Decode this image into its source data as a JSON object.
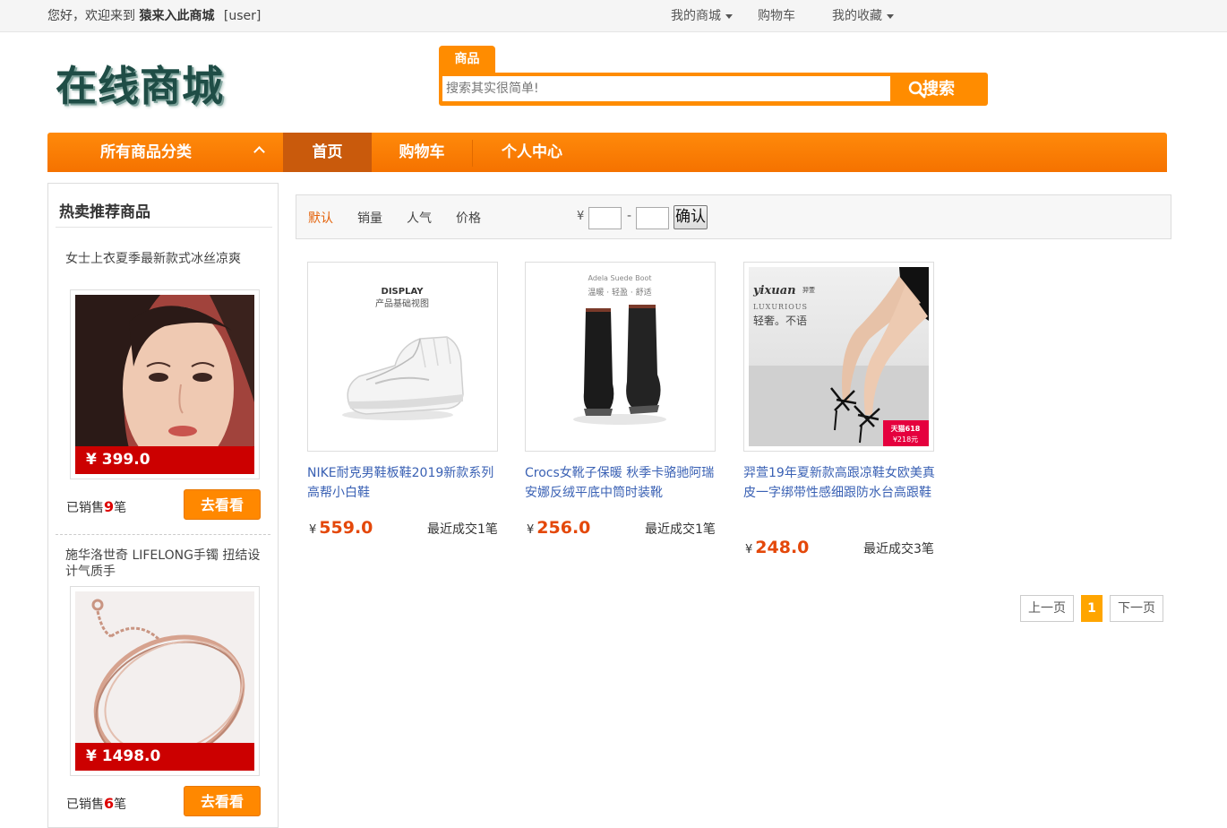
{
  "topbar": {
    "welcome_prefix": "您好，欢迎来到",
    "site_name": "猿来入此商城",
    "user_tag": "[user]",
    "links": [
      {
        "label": "我的商城",
        "dropdown": true
      },
      {
        "label": "购物车",
        "dropdown": false
      },
      {
        "label": "我的收藏",
        "dropdown": true
      }
    ]
  },
  "header": {
    "logo_text": "在线商城",
    "search_tab": "商品",
    "search_placeholder": "搜索其实很简单!",
    "search_button": "搜索"
  },
  "nav": {
    "category_label": "所有商品分类",
    "items": [
      {
        "label": "首页",
        "active": true
      },
      {
        "label": "购物车",
        "active": false
      },
      {
        "label": "个人中心",
        "active": false
      }
    ],
    "accent_color": "#f57200"
  },
  "sidebar": {
    "title": "热卖推荐商品",
    "sold_prefix": "已销售",
    "sold_suffix": "笔",
    "button_label": "去看看",
    "items": [
      {
        "name": "女士上衣夏季最新款式冰丝凉爽",
        "price": "¥ 399.0",
        "sold": "9"
      },
      {
        "name": "施华洛世奇 LIFELONG手镯 扭结设计气质手",
        "price": "¥ 1498.0",
        "sold": "6"
      }
    ]
  },
  "sortbar": {
    "options": [
      {
        "label": "默认",
        "active": true
      },
      {
        "label": "销量",
        "active": false
      },
      {
        "label": "人气",
        "active": false
      },
      {
        "label": "价格",
        "active": false
      }
    ],
    "currency": "¥",
    "range_sep": "-",
    "confirm": "确认"
  },
  "products": [
    {
      "title": "NIKE耐克男鞋板鞋2019新款系列高帮小白鞋",
      "currency": "¥",
      "price": "559.0",
      "sales": "最近成交1笔",
      "image_caption_1": "DISPLAY",
      "image_caption_2": "产品基础视图"
    },
    {
      "title": "Crocs女靴子保暖 秋季卡骆驰阿瑞安娜反绒平底中筒时装靴",
      "currency": "¥",
      "price": "256.0",
      "sales": "最近成交1笔",
      "image_caption_1": "Adela Suede Boot",
      "image_caption_2": "温暖 · 轻盈 · 舒适"
    },
    {
      "title": "羿萱19年夏新款高跟凉鞋女欧美真皮一字绑带性感细跟防水台高跟鞋",
      "currency": "¥",
      "price": "248.0",
      "sales": "最近成交3笔",
      "image_caption_1": "yixuan",
      "image_caption_2": "羿萱",
      "image_caption_3": "LUXURIOUS",
      "image_caption_4": "轻奢。不语",
      "image_badge_1": "天猫618",
      "image_badge_2": "¥218元"
    }
  ],
  "pagination": {
    "prev": "上一页",
    "current": "1",
    "next": "下一页"
  }
}
